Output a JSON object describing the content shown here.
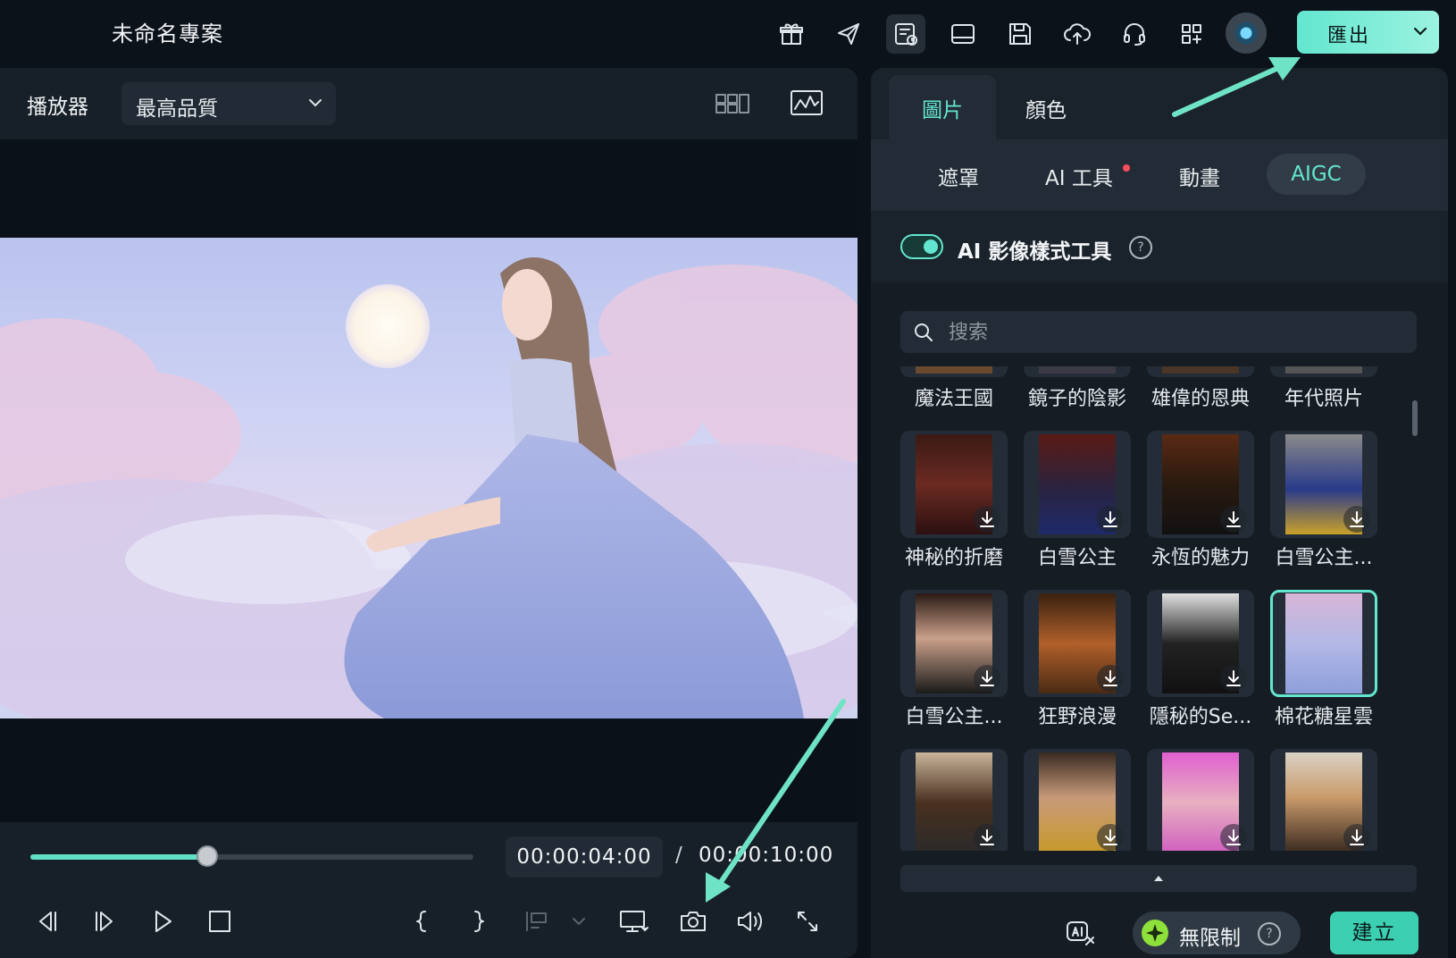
{
  "project": {
    "title": "未命名專案"
  },
  "toolbar": {
    "icons": [
      "gift-icon",
      "send-icon",
      "task-list-icon",
      "layout-icon",
      "save-icon",
      "cloud-upload-icon",
      "headset-icon",
      "apps-icon"
    ],
    "export_label": "匯出"
  },
  "player": {
    "label": "播放器",
    "quality": "最高品質",
    "current_time": "00:00:04:00",
    "separator": "/",
    "total_time": "00:00:10:00",
    "progress": 0.4
  },
  "panel": {
    "tabs": [
      {
        "label": "圖片"
      },
      {
        "label": "顏色"
      }
    ],
    "subtabs": [
      {
        "label": "遮罩"
      },
      {
        "label": "AI 工具"
      },
      {
        "label": "動畫"
      },
      {
        "label": "AIGC"
      }
    ],
    "tool_title": "AI 影像樣式工具",
    "tool_help": "?",
    "search_placeholder": "搜索",
    "row0_labels": [
      "魔法王國",
      "鏡子的陰影",
      "雄偉的恩典",
      "年代照片"
    ],
    "row1_labels": [
      "神秘的折磨",
      "白雪公主",
      "永恆的魅力",
      "白雪公主..."
    ],
    "row2_labels": [
      "白雪公主...",
      "狂野浪漫",
      "隱秘的Se...",
      "棉花糖星雲"
    ],
    "unlimited_label": "無限制",
    "unlimited_help": "?",
    "create_label": "建立"
  },
  "colors": {
    "accent": "#63e6cf",
    "background": "#0c121a",
    "panel": "#151c24"
  }
}
